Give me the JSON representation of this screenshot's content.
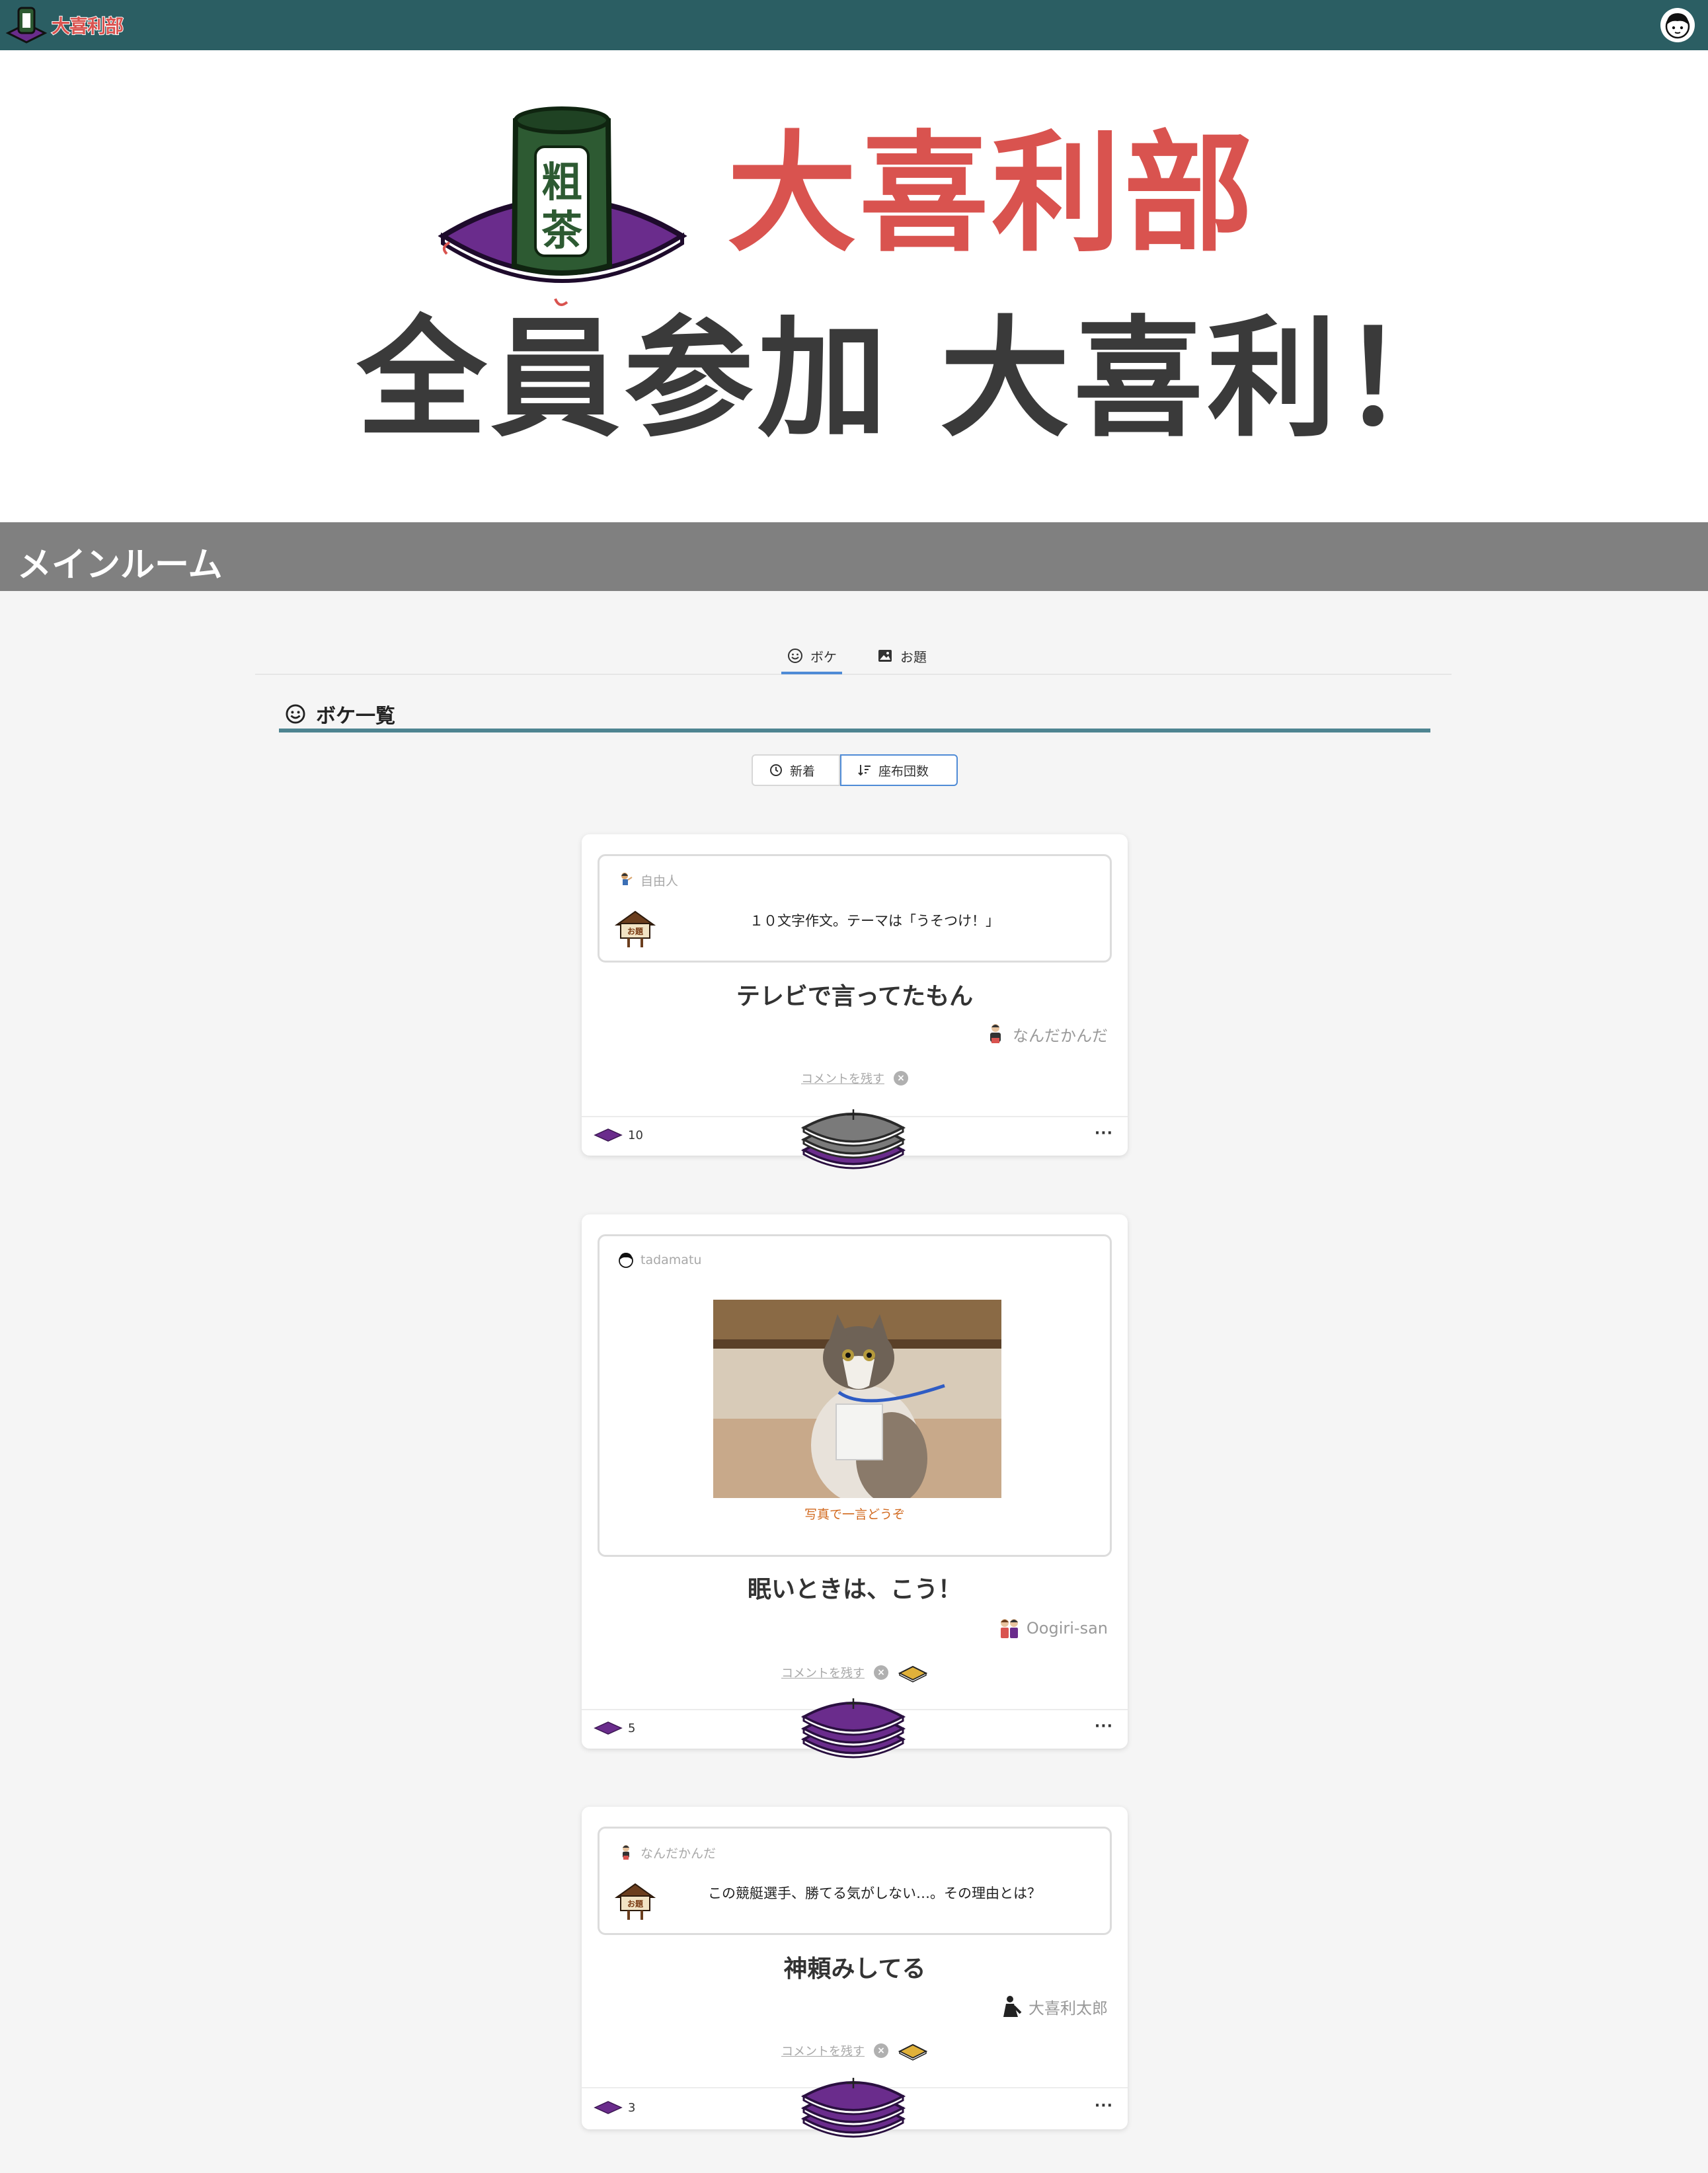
{
  "topbar": {
    "logo_text": "大喜利部"
  },
  "hero": {
    "title": "大喜利部",
    "subtitle": "全員参加 大喜利！",
    "logo_chars": [
      "粗",
      "茶"
    ]
  },
  "room": {
    "title": "メインルーム"
  },
  "tabs": [
    {
      "label": "ボケ",
      "icon": "smile-icon",
      "active": true
    },
    {
      "label": "お題",
      "icon": "image-icon",
      "active": false
    }
  ],
  "section": {
    "title": "ボケ一覧"
  },
  "sort": {
    "new_label": "新着",
    "zabuton_label": "座布団数",
    "selected": "zabuton"
  },
  "cards": [
    {
      "poster": "自由人",
      "theme": "１０文字作文。テーマは「うそつけ！」",
      "answer": "テレビで言ってたもん",
      "author": "なんだかんだ",
      "comment_label": "コメントを残す",
      "count": "10"
    },
    {
      "poster": "tadamatu",
      "photo_caption": "写真で一言どうぞ",
      "answer": "眠いときは、こう！",
      "author": "Oogiri-san",
      "comment_label": "コメントを残す",
      "count": "5"
    },
    {
      "poster": "なんだかんだ",
      "theme": "この競艇選手、勝てる気がしない…。その理由とは？",
      "answer": "神頼みしてる",
      "author": "大喜利太郎",
      "comment_label": "コメントを残す",
      "count": "3"
    }
  ],
  "colors": {
    "topbar": "#2b5e63",
    "brand_red": "#d9534f",
    "zabuton_purple": "#6a2c8c",
    "section_line": "#4e8491"
  }
}
